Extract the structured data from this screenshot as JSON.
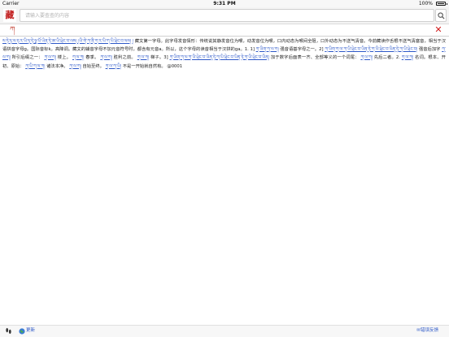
{
  "status_bar": {
    "carrier": "Carrier",
    "time": "9:31 PM",
    "battery_percent": "100%",
    "battery_level": 1.0
  },
  "search": {
    "logo_glyph": "藏",
    "placeholder": "请输入要查查的内容",
    "value": ""
  },
  "entry": {
    "term": "ཀ",
    "definition": {
      "s1": "ས་ཏེ་ཧ་ལ་ཧ་ར་ཡི་ཧྲ་ཏེ་ལྔ་པོ་ཡིན་ཏེ་ཨ་ཡི་ཕྲེང་བ་ལས། །ཡི་གེ་ཀ་ནི་ཀ་ར་ཡི་ཀ་ཡི་ཕྲེང་བ་ལས། །",
      "s2": "藏文第一字母。此字母发音情形：传统说其静发音位为喉，动发音位为喉，口内动态为喉间全阻，口外动态为不送气清音。今前藏读作舌根不送气清塞音，相当于汉语拼音字母g。国际音标k。高降调。藏文的辅音字母不加元音符号时，都含有元音a。所以，这个字母的读音相当于汉拼的ga。1. 1]",
      "s3": "ཀ་ཡིག་ཀ་ལ་ཀ།",
      "s4": "强音语基字母之一。2]",
      "s5": "ཀ་ཡིག་ཀ་ལ་ཀ་ཡི་ཕྲེང་བ་ཡིན་ཏེ་ཀ་ཡི་ཕྲེང་བ་ཡིན་ཏེ་ཀ་ཡི་ཕྲེང་བ།",
      "s6": "强音后加字",
      "s7": "ཀ་ལ་ཀ།",
      "s8": "所引后缀之一：",
      "s9": "ཀ་ལ་ཀ།",
      "s10": "楼上。",
      "s11": "ཀ་ལ་ཀ།",
      "s12": "春季。",
      "s13": "ཀ་ལ་ཀ།",
      "s14": "胜利之前。",
      "s15": "ཀ་ལ་ཀ།",
      "s16": "梯子。3]",
      "s17": "ཀ་ཡིག་ཀ་ལ་ཀ་ཡི་ཕྲེང་བ་ཡིན་ཏེ་ཀ་ཡི་ཕྲེང་བ་ཡིན་ཏེ་ཀ་ཡི་ཕྲེང་བ་ཡིན།",
      "s18": "加于数字后面表一齐、全部等义的一个词尾：",
      "s19": "ཀ་ལ་ཀ།",
      "s20": "先后二者。2.",
      "s21": "ཀ་ལ་ཀ།",
      "s22": "名词。根本、开初、原始：",
      "s23": "ཀ་ཡི་ཀ་ལ་ཀ།",
      "s24": "诸法本净。",
      "s25": "ཀ་ལ་ཀ།",
      "s26": "自始至终。",
      "s27": "ཀ་ལ་ཀ་ཡི།",
      "s28": "不是一开始就自然有。",
      "ref": "@0001"
    }
  },
  "bottom_bar": {
    "update_label": "更新",
    "feedback_label": "✉错误反馈"
  },
  "colors": {
    "accent_red": "#c01a1a",
    "link_blue": "#2d58c8",
    "close_red": "#d11b1b"
  },
  "icons": {
    "search": "magnifier-icon",
    "close": "close-icon",
    "footprint": "footprint-icon",
    "globe": "globe-icon"
  }
}
